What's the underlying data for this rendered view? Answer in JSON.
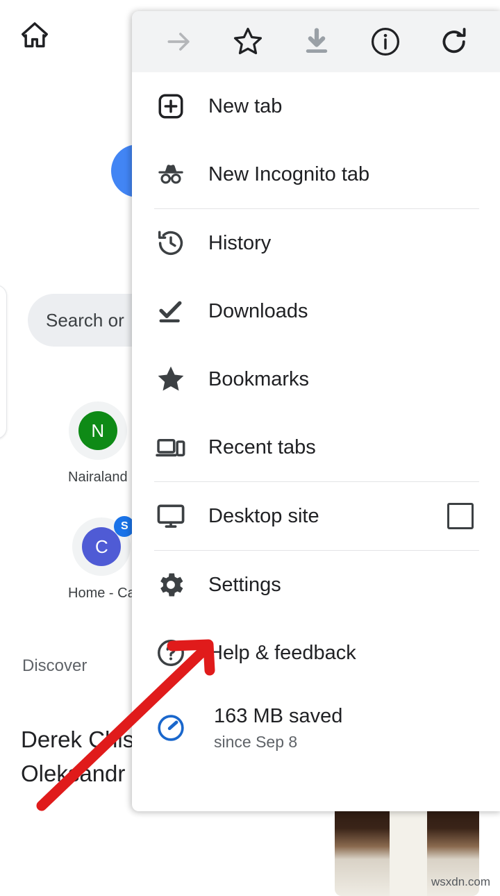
{
  "background": {
    "home_icon": "home-icon",
    "search_placeholder": "Search or",
    "logo": "google-g-logo",
    "shortcuts": [
      {
        "letter": "N",
        "label": "Nairaland",
        "color": "#0e8a16",
        "badge": ""
      },
      {
        "letter": "C",
        "label": "Home - Ca",
        "color": "#4f5bd5",
        "badge": "S"
      }
    ],
    "discover_heading": "Discover",
    "story_headline": "Derek Chis 'mental' lis five heavyweights no Oleksandr Usyk or Deontay Wilder",
    "watermark": "wsxdn.com"
  },
  "menu": {
    "toolbar": [
      {
        "name": "forward-arrow-icon",
        "label": "Forward",
        "enabled": false
      },
      {
        "name": "star-icon",
        "label": "Bookmark",
        "enabled": true
      },
      {
        "name": "download-icon",
        "label": "Download page",
        "enabled": false
      },
      {
        "name": "info-icon",
        "label": "Page info",
        "enabled": true
      },
      {
        "name": "reload-icon",
        "label": "Reload",
        "enabled": true
      }
    ],
    "items": [
      {
        "id": "new-tab",
        "icon": "new-tab-icon",
        "label": "New tab"
      },
      {
        "id": "new-incognito",
        "icon": "incognito-icon",
        "label": "New Incognito tab"
      },
      {
        "id": "history",
        "icon": "history-icon",
        "label": "History"
      },
      {
        "id": "downloads",
        "icon": "downloads-icon",
        "label": "Downloads"
      },
      {
        "id": "bookmarks",
        "icon": "bookmarks-star-icon",
        "label": "Bookmarks"
      },
      {
        "id": "recent-tabs",
        "icon": "recent-tabs-icon",
        "label": "Recent tabs"
      },
      {
        "id": "desktop-site",
        "icon": "desktop-monitor-icon",
        "label": "Desktop site",
        "checkbox": true,
        "checked": false
      },
      {
        "id": "settings",
        "icon": "gear-icon",
        "label": "Settings"
      },
      {
        "id": "help-feedback",
        "icon": "help-circle-icon",
        "label": "Help & feedback"
      }
    ],
    "data_saver": {
      "icon": "data-saver-gauge-icon",
      "primary": "163 MB saved",
      "secondary": "since Sep 8",
      "color": "#1a73e8"
    }
  },
  "annotation": {
    "name": "red-arrow-pointing-to-settings",
    "color": "#e01b1b"
  }
}
